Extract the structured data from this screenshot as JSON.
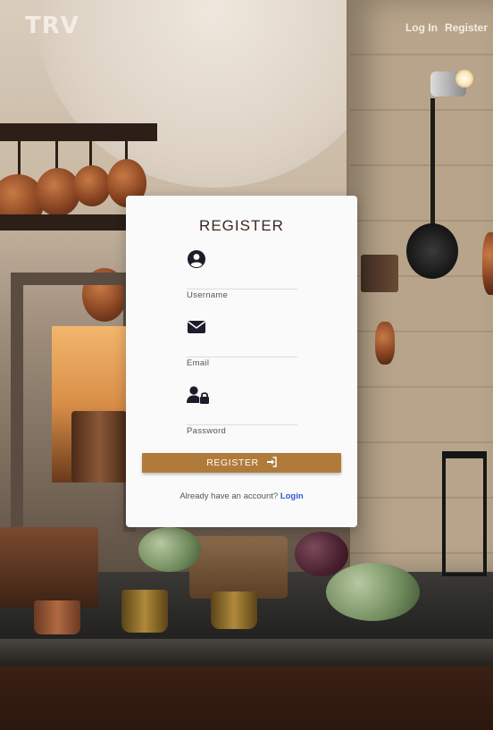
{
  "header": {
    "logo": "TRV",
    "nav": {
      "login": "Log In",
      "register": "Register"
    }
  },
  "form": {
    "title": "REGISTER",
    "fields": {
      "username": {
        "label": "Username",
        "value": "",
        "icon": "user-circle-icon"
      },
      "email": {
        "label": "Email",
        "value": "",
        "icon": "envelope-icon"
      },
      "password": {
        "label": "Password",
        "value": "",
        "icon": "user-lock-icon"
      }
    },
    "submit_label": "REGISTER",
    "submit_icon": "sign-in-icon",
    "footer_text": "Already have an account?",
    "footer_link": "Login"
  },
  "colors": {
    "accent": "#b07b3a",
    "link": "#2b5bd0",
    "card": "#fafafa",
    "title": "#3a2a22"
  }
}
